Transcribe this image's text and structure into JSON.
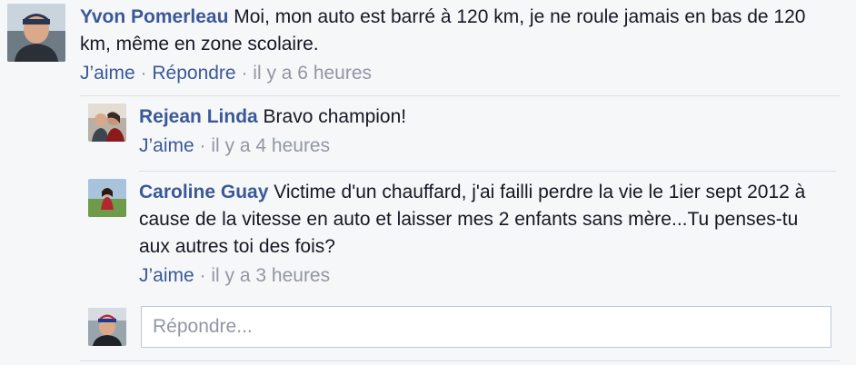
{
  "comments": [
    {
      "author": "Yvon Pomerleau",
      "text": "Moi, mon auto est barré à 120 km, je ne roule jamais en bas de 120 km, même en zone scolaire.",
      "like_label": "J’aime",
      "reply_label": "Répondre",
      "separator": "·",
      "timestamp": "il y a 6 heures"
    }
  ],
  "replies": [
    {
      "author": "Rejean Linda",
      "text": "Bravo champion!",
      "like_label": "J’aime",
      "separator": "·",
      "timestamp": "il y a 4 heures"
    },
    {
      "author": "Caroline Guay",
      "text": "Victime d'un chauffard, j'ai failli perdre la vie le 1ier sept 2012 à cause de la vitesse en auto et laisser mes 2 enfants sans mère...Tu penses-tu aux autres toi des fois?",
      "like_label": "J’aime",
      "separator": "·",
      "timestamp": "il y a 3 heures"
    }
  ],
  "reply_input": {
    "placeholder": "Répondre...",
    "value": ""
  },
  "colors": {
    "link": "#3b5998",
    "meta": "#9197a3",
    "background": "#f6f7f9",
    "divider": "#dcdee3"
  },
  "icons": {
    "top_avatar": "avatar-yvon-pomerleau",
    "reply1_avatar": "avatar-rejean-linda",
    "reply2_avatar": "avatar-caroline-guay",
    "composer_avatar": "avatar-current-user"
  }
}
